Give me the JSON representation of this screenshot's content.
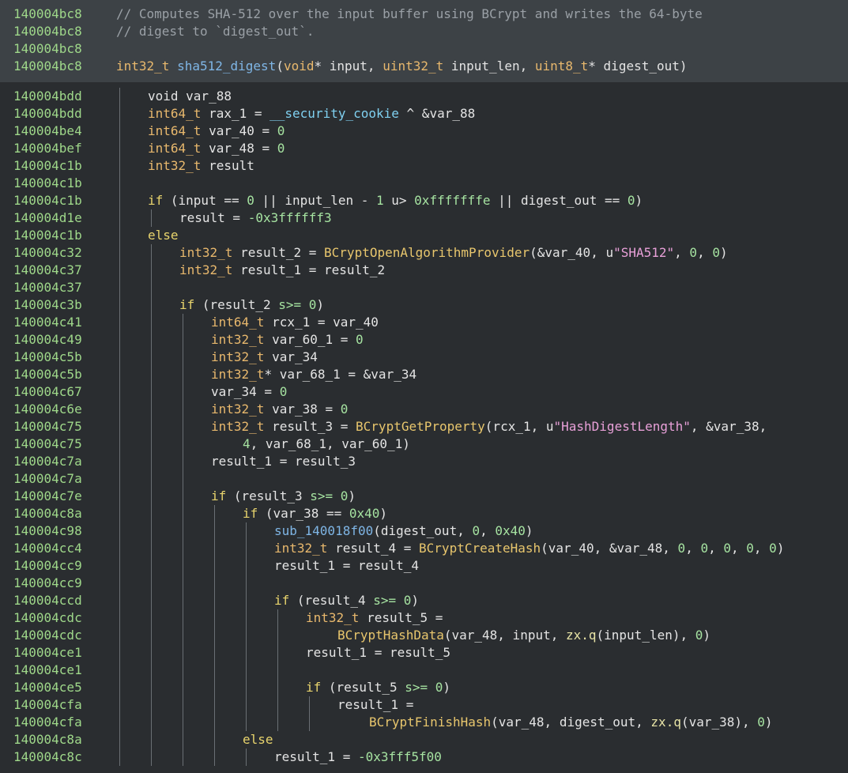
{
  "colors": {
    "address": "#9fd88a",
    "comment": "#9aa0a6",
    "type": "#e8b86d",
    "function": "#7fb6e6",
    "import": "#e8c66d",
    "keyword": "#e8d46d",
    "number": "#a6e3a1",
    "string": "#e8a0d8",
    "header_bg": "#3d4246",
    "body_bg": "#2a2d30"
  },
  "header_lines": [
    {
      "addr": "140004bc8",
      "indent": 0,
      "tokens": [
        [
          "c",
          "// Computes SHA-512 over the input buffer using BCrypt and writes the 64-byte"
        ]
      ]
    },
    {
      "addr": "140004bc8",
      "indent": 0,
      "tokens": [
        [
          "c",
          "// digest to `digest_out`."
        ]
      ]
    },
    {
      "addr": "140004bc8",
      "indent": 0,
      "tokens": []
    },
    {
      "addr": "140004bc8",
      "indent": 0,
      "tokens": [
        [
          "t",
          "int32_t"
        ],
        [
          "p",
          " "
        ],
        [
          "f",
          "sha512_digest"
        ],
        [
          "p",
          "("
        ],
        [
          "t",
          "void"
        ],
        [
          "p",
          "* input, "
        ],
        [
          "t",
          "uint32_t"
        ],
        [
          "p",
          " input_len, "
        ],
        [
          "t",
          "uint8_t"
        ],
        [
          "p",
          "* digest_out)"
        ]
      ]
    }
  ],
  "body_lines": [
    {
      "addr": "140004bdd",
      "indent": 1,
      "tokens": [
        [
          "p",
          "void var_88"
        ]
      ]
    },
    {
      "addr": "140004bdd",
      "indent": 1,
      "tokens": [
        [
          "t",
          "int64_t"
        ],
        [
          "p",
          " rax_1 = "
        ],
        [
          "g",
          "__security_cookie"
        ],
        [
          "p",
          " ^ &var_88"
        ]
      ]
    },
    {
      "addr": "140004be4",
      "indent": 1,
      "tokens": [
        [
          "t",
          "int64_t"
        ],
        [
          "p",
          " var_40 = "
        ],
        [
          "n",
          "0"
        ]
      ]
    },
    {
      "addr": "140004bef",
      "indent": 1,
      "tokens": [
        [
          "t",
          "int64_t"
        ],
        [
          "p",
          " var_48 = "
        ],
        [
          "n",
          "0"
        ]
      ]
    },
    {
      "addr": "140004c1b",
      "indent": 1,
      "tokens": [
        [
          "t",
          "int32_t"
        ],
        [
          "p",
          " result"
        ]
      ]
    },
    {
      "addr": "140004c1b",
      "indent": 1,
      "tokens": []
    },
    {
      "addr": "140004c1b",
      "indent": 1,
      "tokens": [
        [
          "k",
          "if"
        ],
        [
          "p",
          " (input == "
        ],
        [
          "n",
          "0"
        ],
        [
          "p",
          " || input_len - "
        ],
        [
          "n",
          "1"
        ],
        [
          "p",
          " u> "
        ],
        [
          "n",
          "0xfffffffe"
        ],
        [
          "p",
          " || digest_out == "
        ],
        [
          "n",
          "0"
        ],
        [
          "p",
          ")"
        ]
      ]
    },
    {
      "addr": "140004d1e",
      "indent": 2,
      "tokens": [
        [
          "p",
          "result = "
        ],
        [
          "n",
          "-0x3ffffff3"
        ]
      ]
    },
    {
      "addr": "140004c1b",
      "indent": 1,
      "tokens": [
        [
          "k",
          "else"
        ]
      ]
    },
    {
      "addr": "140004c32",
      "indent": 2,
      "tokens": [
        [
          "t",
          "int32_t"
        ],
        [
          "p",
          " result_2 = "
        ],
        [
          "i",
          "BCryptOpenAlgorithmProvider"
        ],
        [
          "p",
          "(&var_40, "
        ],
        [
          "x",
          "u"
        ],
        [
          "s",
          "\"SHA512\""
        ],
        [
          "p",
          ", "
        ],
        [
          "n",
          "0"
        ],
        [
          "p",
          ", "
        ],
        [
          "n",
          "0"
        ],
        [
          "p",
          ")"
        ]
      ]
    },
    {
      "addr": "140004c37",
      "indent": 2,
      "tokens": [
        [
          "t",
          "int32_t"
        ],
        [
          "p",
          " result_1 = result_2"
        ]
      ]
    },
    {
      "addr": "140004c37",
      "indent": 2,
      "tokens": []
    },
    {
      "addr": "140004c3b",
      "indent": 2,
      "tokens": [
        [
          "k",
          "if"
        ],
        [
          "p",
          " (result_2 "
        ],
        [
          "n",
          "s>="
        ],
        [
          "p",
          " "
        ],
        [
          "n",
          "0"
        ],
        [
          "p",
          ")"
        ]
      ]
    },
    {
      "addr": "140004c41",
      "indent": 3,
      "tokens": [
        [
          "t",
          "int64_t"
        ],
        [
          "p",
          " rcx_1 = var_40"
        ]
      ]
    },
    {
      "addr": "140004c49",
      "indent": 3,
      "tokens": [
        [
          "t",
          "int32_t"
        ],
        [
          "p",
          " var_60_1 = "
        ],
        [
          "n",
          "0"
        ]
      ]
    },
    {
      "addr": "140004c5b",
      "indent": 3,
      "tokens": [
        [
          "t",
          "int32_t"
        ],
        [
          "p",
          " var_34"
        ]
      ]
    },
    {
      "addr": "140004c5b",
      "indent": 3,
      "tokens": [
        [
          "t",
          "int32_t"
        ],
        [
          "p",
          "* var_68_1 = &var_34"
        ]
      ]
    },
    {
      "addr": "140004c67",
      "indent": 3,
      "tokens": [
        [
          "p",
          "var_34 = "
        ],
        [
          "n",
          "0"
        ]
      ]
    },
    {
      "addr": "140004c6e",
      "indent": 3,
      "tokens": [
        [
          "t",
          "int32_t"
        ],
        [
          "p",
          " var_38 = "
        ],
        [
          "n",
          "0"
        ]
      ]
    },
    {
      "addr": "140004c75",
      "indent": 3,
      "tokens": [
        [
          "t",
          "int32_t"
        ],
        [
          "p",
          " result_3 = "
        ],
        [
          "i",
          "BCryptGetProperty"
        ],
        [
          "p",
          "(rcx_1, "
        ],
        [
          "x",
          "u"
        ],
        [
          "s",
          "\"HashDigestLength\""
        ],
        [
          "p",
          ", &var_38,"
        ]
      ]
    },
    {
      "addr": "140004c75",
      "indent": 3,
      "extra": 1,
      "tokens": [
        [
          "n",
          "4"
        ],
        [
          "p",
          ", var_68_1, var_60_1)"
        ]
      ]
    },
    {
      "addr": "140004c7a",
      "indent": 3,
      "tokens": [
        [
          "p",
          "result_1 = result_3"
        ]
      ]
    },
    {
      "addr": "140004c7a",
      "indent": 3,
      "tokens": []
    },
    {
      "addr": "140004c7e",
      "indent": 3,
      "tokens": [
        [
          "k",
          "if"
        ],
        [
          "p",
          " (result_3 "
        ],
        [
          "n",
          "s>="
        ],
        [
          "p",
          " "
        ],
        [
          "n",
          "0"
        ],
        [
          "p",
          ")"
        ]
      ]
    },
    {
      "addr": "140004c8a",
      "indent": 4,
      "tokens": [
        [
          "k",
          "if"
        ],
        [
          "p",
          " (var_38 == "
        ],
        [
          "n",
          "0x40"
        ],
        [
          "p",
          ")"
        ]
      ]
    },
    {
      "addr": "140004c98",
      "indent": 5,
      "tokens": [
        [
          "f",
          "sub_140018f00"
        ],
        [
          "p",
          "(digest_out, "
        ],
        [
          "n",
          "0"
        ],
        [
          "p",
          ", "
        ],
        [
          "n",
          "0x40"
        ],
        [
          "p",
          ")"
        ]
      ]
    },
    {
      "addr": "140004cc4",
      "indent": 5,
      "tokens": [
        [
          "t",
          "int32_t"
        ],
        [
          "p",
          " result_4 = "
        ],
        [
          "i",
          "BCryptCreateHash"
        ],
        [
          "p",
          "(var_40, &var_48, "
        ],
        [
          "n",
          "0"
        ],
        [
          "p",
          ", "
        ],
        [
          "n",
          "0"
        ],
        [
          "p",
          ", "
        ],
        [
          "n",
          "0"
        ],
        [
          "p",
          ", "
        ],
        [
          "n",
          "0"
        ],
        [
          "p",
          ", "
        ],
        [
          "n",
          "0"
        ],
        [
          "p",
          ")"
        ]
      ]
    },
    {
      "addr": "140004cc9",
      "indent": 5,
      "tokens": [
        [
          "p",
          "result_1 = result_4"
        ]
      ]
    },
    {
      "addr": "140004cc9",
      "indent": 5,
      "tokens": []
    },
    {
      "addr": "140004ccd",
      "indent": 5,
      "tokens": [
        [
          "k",
          "if"
        ],
        [
          "p",
          " (result_4 "
        ],
        [
          "n",
          "s>="
        ],
        [
          "p",
          " "
        ],
        [
          "n",
          "0"
        ],
        [
          "p",
          ")"
        ]
      ]
    },
    {
      "addr": "140004cdc",
      "indent": 6,
      "tokens": [
        [
          "t",
          "int32_t"
        ],
        [
          "p",
          " result_5 ="
        ]
      ]
    },
    {
      "addr": "140004cdc",
      "indent": 6,
      "extra": 1,
      "tokens": [
        [
          "i",
          "BCryptHashData"
        ],
        [
          "p",
          "(var_48, input, "
        ],
        [
          "y",
          "zx.q"
        ],
        [
          "p",
          "(input_len), "
        ],
        [
          "n",
          "0"
        ],
        [
          "p",
          ")"
        ]
      ]
    },
    {
      "addr": "140004ce1",
      "indent": 6,
      "tokens": [
        [
          "p",
          "result_1 = result_5"
        ]
      ]
    },
    {
      "addr": "140004ce1",
      "indent": 6,
      "tokens": []
    },
    {
      "addr": "140004ce5",
      "indent": 6,
      "tokens": [
        [
          "k",
          "if"
        ],
        [
          "p",
          " (result_5 "
        ],
        [
          "n",
          "s>="
        ],
        [
          "p",
          " "
        ],
        [
          "n",
          "0"
        ],
        [
          "p",
          ")"
        ]
      ]
    },
    {
      "addr": "140004cfa",
      "indent": 7,
      "tokens": [
        [
          "p",
          "result_1 ="
        ]
      ]
    },
    {
      "addr": "140004cfa",
      "indent": 7,
      "extra": 1,
      "tokens": [
        [
          "i",
          "BCryptFinishHash"
        ],
        [
          "p",
          "(var_48, digest_out, "
        ],
        [
          "y",
          "zx.q"
        ],
        [
          "p",
          "(var_38), "
        ],
        [
          "n",
          "0"
        ],
        [
          "p",
          ")"
        ]
      ]
    },
    {
      "addr": "140004c8a",
      "indent": 4,
      "tokens": [
        [
          "k",
          "else"
        ]
      ]
    },
    {
      "addr": "140004c8c",
      "indent": 5,
      "tokens": [
        [
          "p",
          "result_1 = "
        ],
        [
          "n",
          "-0x3fff5f00"
        ]
      ]
    }
  ]
}
